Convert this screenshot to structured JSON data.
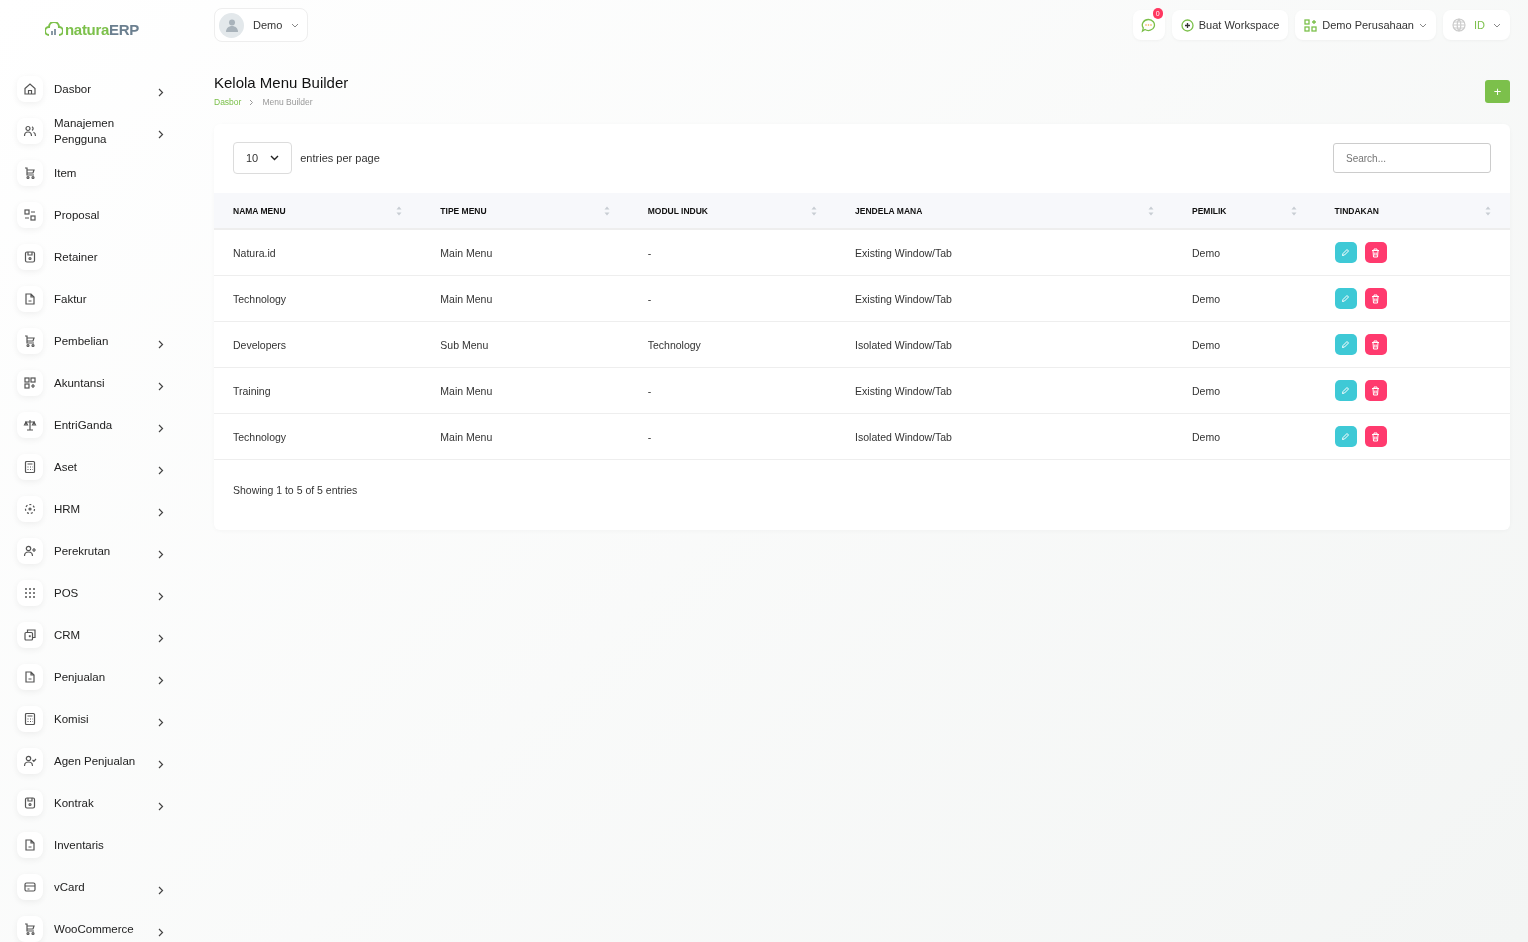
{
  "logo": {
    "brand": "natura",
    "suffix": "ERP"
  },
  "user_menu": {
    "name": "Demo"
  },
  "topbar": {
    "notification_count": "0",
    "create_button": "Buat Workspace",
    "company_select": "Demo Perusahaan",
    "language_select": "ID"
  },
  "sidebar": {
    "items": [
      {
        "label": "Dasbor",
        "expandable": true
      },
      {
        "label": "Manajemen Pengguna",
        "expandable": true
      },
      {
        "label": "Item",
        "expandable": false
      },
      {
        "label": "Proposal",
        "expandable": false
      },
      {
        "label": "Retainer",
        "expandable": false
      },
      {
        "label": "Faktur",
        "expandable": false
      },
      {
        "label": "Pembelian",
        "expandable": true
      },
      {
        "label": "Akuntansi",
        "expandable": true
      },
      {
        "label": "EntriGanda",
        "expandable": true
      },
      {
        "label": "Aset",
        "expandable": true
      },
      {
        "label": "HRM",
        "expandable": true
      },
      {
        "label": "Perekrutan",
        "expandable": true
      },
      {
        "label": "POS",
        "expandable": true
      },
      {
        "label": "CRM",
        "expandable": true
      },
      {
        "label": "Penjualan",
        "expandable": true
      },
      {
        "label": "Komisi",
        "expandable": true
      },
      {
        "label": "Agen Penjualan",
        "expandable": true
      },
      {
        "label": "Kontrak",
        "expandable": true
      },
      {
        "label": "Inventaris",
        "expandable": false
      },
      {
        "label": "vCard",
        "expandable": true
      },
      {
        "label": "WooCommerce",
        "expandable": true
      }
    ]
  },
  "page": {
    "title": "Kelola Menu Builder",
    "breadcrumb": [
      "Dasbor",
      "Menu Builder"
    ],
    "add_button": "+"
  },
  "table": {
    "page_size": "10",
    "page_size_label": "entries per page",
    "search": {
      "placeholder": "Search..."
    },
    "columns": [
      "NAMA MENU",
      "TIPE MENU",
      "MODUL INDUK",
      "JENDELA MANA",
      "PEMILIK",
      "TINDAKAN"
    ],
    "rows": [
      [
        "Natura.id",
        "Main Menu",
        "-",
        "Existing Window/Tab",
        "Demo"
      ],
      [
        "Technology",
        "Main Menu",
        "-",
        "Existing Window/Tab",
        "Demo"
      ],
      [
        "Developers",
        "Sub Menu",
        "Technology",
        "Isolated Window/Tab",
        "Demo"
      ],
      [
        "Training",
        "Main Menu",
        "-",
        "Existing Window/Tab",
        "Demo"
      ],
      [
        "Technology",
        "Main Menu",
        "-",
        "Isolated Window/Tab",
        "Demo"
      ]
    ],
    "footer": "Showing 1 to 5 of 5 entries"
  }
}
